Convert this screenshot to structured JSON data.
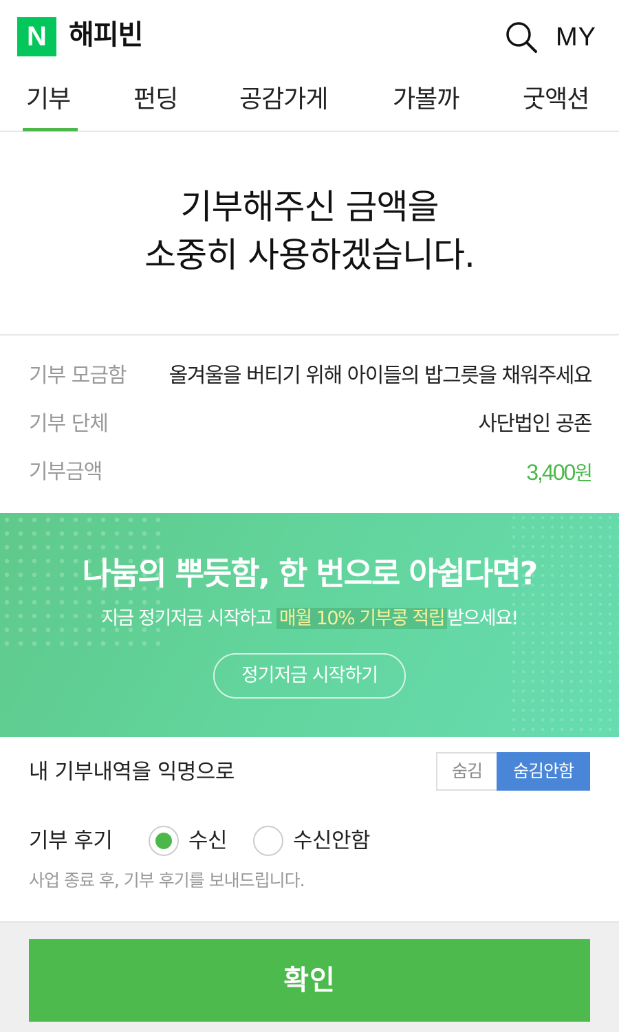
{
  "header": {
    "logo_letter": "N",
    "brand": "해피빈",
    "my_label": "MY",
    "search_icon": "search-icon"
  },
  "tabs": [
    {
      "label": "기부",
      "active": true
    },
    {
      "label": "펀딩",
      "active": false
    },
    {
      "label": "공감가게",
      "active": false
    },
    {
      "label": "가볼까",
      "active": false
    },
    {
      "label": "굿액션",
      "active": false
    }
  ],
  "hero": {
    "line1": "기부해주신 금액을",
    "line2": "소중히 사용하겠습니다."
  },
  "info": {
    "fund_label": "기부 모금함",
    "fund_value": "올겨울을 버티기 위해 아이들의 밥그릇을 채워주세요",
    "org_label": "기부 단체",
    "org_value": "사단법인 공존",
    "amount_label": "기부금액",
    "amount_number": "3,400",
    "amount_unit": "원"
  },
  "banner": {
    "title": "나눔의 뿌듯함, 한 번으로 아쉽다면?",
    "sub_prefix": "지금 정기저금 시작하고 ",
    "sub_highlight": "매월 10% 기부콩 적립",
    "sub_suffix": "받으세요!",
    "button": "정기저금 시작하기"
  },
  "anonymous": {
    "label": "내 기부내역을 익명으로",
    "option_hide": "숨김",
    "option_show": "숨김안함",
    "selected": "숨김안함"
  },
  "review": {
    "label": "기부 후기",
    "option_receive": "수신",
    "option_decline": "수신안함",
    "selected": "수신",
    "note": "사업 종료 후, 기부 후기를 보내드립니다."
  },
  "footer": {
    "confirm": "확인"
  },
  "colors": {
    "brand_green": "#03c75a",
    "accent_green": "#4cb84c",
    "toggle_blue": "#4a86d8"
  }
}
